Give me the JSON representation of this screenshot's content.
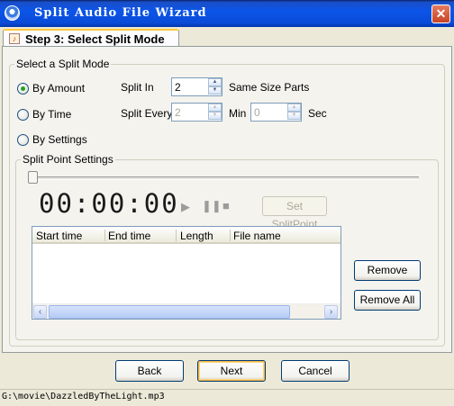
{
  "window": {
    "title": "Split Audio File Wizard",
    "close_glyph": "✕",
    "icon": "app-disc-icon"
  },
  "tab": {
    "label": "Step 3: Select Split Mode",
    "icon": "wizard-step-icon"
  },
  "split_mode": {
    "group_label": "Select a  Split Mode",
    "options": [
      {
        "label": "By Amount",
        "checked": true
      },
      {
        "label": "By Time",
        "checked": false
      },
      {
        "label": "By Settings",
        "checked": false
      }
    ],
    "amount": {
      "label": "Split In",
      "value": "2",
      "suffix": "Same Size Parts"
    },
    "time": {
      "label": "Split Every",
      "minutes_value": "2",
      "minutes_label": "Min",
      "seconds_value": "0",
      "seconds_label": "Sec"
    }
  },
  "split_points": {
    "group_label": "Split Point Settings",
    "slider_position": 0,
    "time_display": "00:00:00",
    "set_button": "Set SplitPoint",
    "columns": [
      "Start time",
      "End time",
      "Length",
      "File name"
    ],
    "rows": [],
    "remove_button": "Remove",
    "remove_all_button": "Remove All"
  },
  "footer": {
    "back": "Back",
    "next": "Next",
    "cancel": "Cancel"
  },
  "status": {
    "path": "G:\\movie\\DazzledByTheLight.mp3"
  }
}
